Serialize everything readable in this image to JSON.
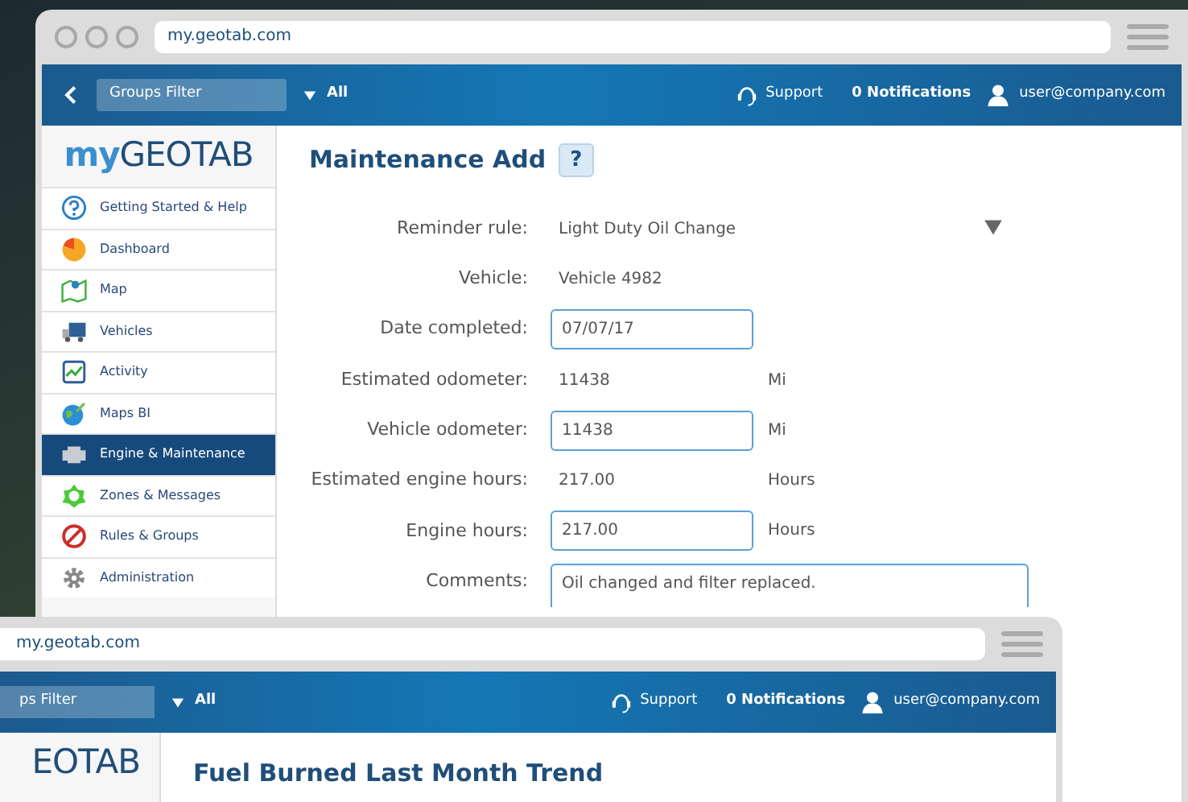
{
  "back_window": {
    "url": "my.geotab.com",
    "nav": {
      "groups_filter": "Groups Filter",
      "filter_value": "All",
      "support": "Support",
      "notifications": "0 Notifications",
      "user": "user@company.com"
    },
    "logo": {
      "prefix": "my",
      "name": "GEOTAB"
    },
    "sidebar": {
      "items": [
        {
          "label": "Getting Started & Help",
          "selected": false
        },
        {
          "label": "Dashboard",
          "selected": false
        },
        {
          "label": "Map",
          "selected": false
        },
        {
          "label": "Vehicles",
          "selected": false
        },
        {
          "label": "Activity",
          "selected": false
        },
        {
          "label": "Maps BI",
          "selected": false
        },
        {
          "label": "Engine & Maintenance",
          "selected": true
        },
        {
          "label": "Zones & Messages",
          "selected": false
        },
        {
          "label": "Rules & Groups",
          "selected": false
        },
        {
          "label": "Administration",
          "selected": false
        }
      ]
    },
    "page_title": "Maintenance Add",
    "help_button": "?",
    "form": [
      {
        "kind": "select",
        "label": "Reminder rule:",
        "value": "Light Duty Oil Change"
      },
      {
        "kind": "text",
        "label": "Vehicle:",
        "value": "Vehicle 4982"
      },
      {
        "kind": "field",
        "label": "Date completed:",
        "value": "07/07/17"
      },
      {
        "kind": "text",
        "label": "Estimated odometer:",
        "value": "11438",
        "unit": "Mi"
      },
      {
        "kind": "field",
        "label": "Vehicle odometer:",
        "value": "11438",
        "unit": "Mi"
      },
      {
        "kind": "text",
        "label": "Estimated engine hours:",
        "value": "217.00",
        "unit": "Hours"
      },
      {
        "kind": "field",
        "label": "Engine hours:",
        "value": "217.00",
        "unit": "Hours"
      },
      {
        "kind": "textarea",
        "label": "Comments:",
        "value": "Oil changed and filter replaced."
      }
    ]
  },
  "front_window": {
    "url": "my.geotab.com",
    "nav": {
      "groups_filter": "ps Filter",
      "filter_value": "All",
      "support": "Support",
      "notifications": "0 Notifications",
      "user": "user@company.com"
    },
    "logo": "EOTAB",
    "page_title": "Fuel Burned Last Month Trend"
  }
}
